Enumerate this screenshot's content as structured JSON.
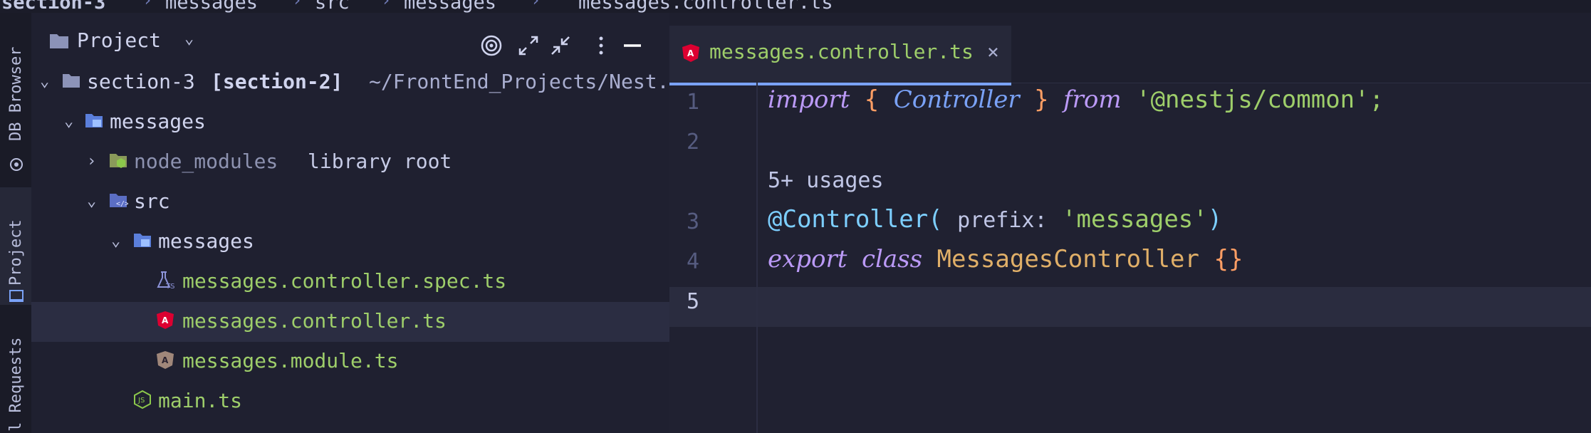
{
  "breadcrumb": {
    "items": [
      "section-3",
      "messages",
      "src",
      "messages",
      "messages.controller.ts"
    ]
  },
  "left_bar": {
    "tabs": [
      "DB Browser",
      "Project",
      "l Requests"
    ]
  },
  "project_panel": {
    "title": "Project",
    "tree": [
      {
        "name": "section-3",
        "branch": "[section-2]",
        "path": "~/FrontEnd_Projects/Nest."
      },
      {
        "name": "messages"
      },
      {
        "name": "node_modules",
        "suffix": "library root"
      },
      {
        "name": "src"
      },
      {
        "name": "messages"
      },
      {
        "name": "messages.controller.spec.ts"
      },
      {
        "name": "messages.controller.ts"
      },
      {
        "name": "messages.module.ts"
      },
      {
        "name": "main.ts"
      }
    ]
  },
  "editor": {
    "tab": {
      "label": "messages.controller.ts",
      "close": "×"
    },
    "line_numbers": [
      "1",
      "2",
      "3",
      "4",
      "5"
    ],
    "code": {
      "l1": {
        "import": "import",
        "open": "{",
        "name": "Controller",
        "close": "}",
        "from": "from",
        "module": "'@nestjs/common';"
      },
      "usages": "5+ usages",
      "l3": {
        "decorator": "@Controller(",
        "hint": "prefix:",
        "arg": "'messages'",
        "paren": ")"
      },
      "l4": {
        "export": "export",
        "class": "class",
        "name": "MessagesController",
        "body": "{}"
      }
    }
  },
  "colors": {
    "accent": "#7aa2f7",
    "string": "#9ece6a",
    "keyword": "#bb9af7",
    "class_name": "#e0af68",
    "brace": "#ff9e64",
    "angular": "#dd0031",
    "node": "#8cc84b"
  },
  "icons": {
    "angular": "angular-icon",
    "test": "test-file-icon",
    "node": "nodejs-icon",
    "folder": "folder-icon"
  }
}
